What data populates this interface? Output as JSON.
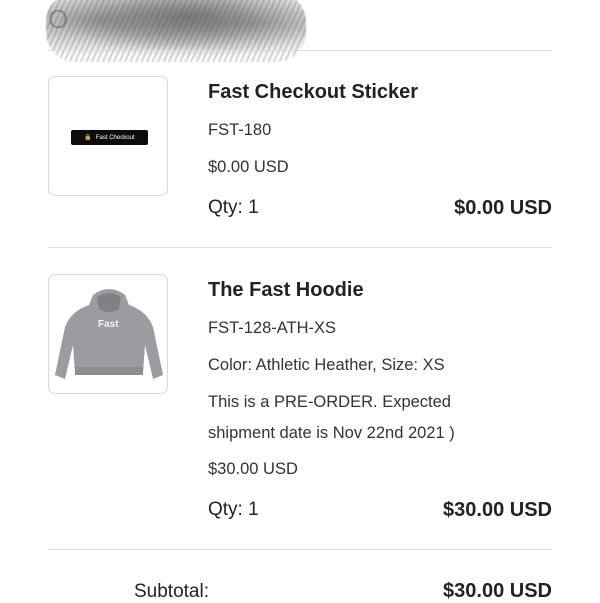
{
  "header": {
    "scribble_letter": "O"
  },
  "items": [
    {
      "name": "Fast Checkout Sticker",
      "sku": "FST-180",
      "unit_price": "$0.00 USD",
      "qty": "Qty: 1",
      "line_total": "$0.00 USD",
      "image_label": "Fast Checkout"
    },
    {
      "name": "The Fast Hoodie",
      "sku": "FST-128-ATH-XS",
      "variant": "Color: Athletic Heather, Size: XS",
      "note_line1": "This is a PRE-ORDER. Expected",
      "note_line2": "shipment date is Nov 22nd 2021 )",
      "unit_price": "$30.00 USD",
      "qty": "Qty: 1",
      "line_total": "$30.00 USD",
      "image_label": "Fast"
    }
  ],
  "summary": {
    "subtotal_label": "Subtotal:",
    "subtotal_value": "$30.00 USD"
  }
}
